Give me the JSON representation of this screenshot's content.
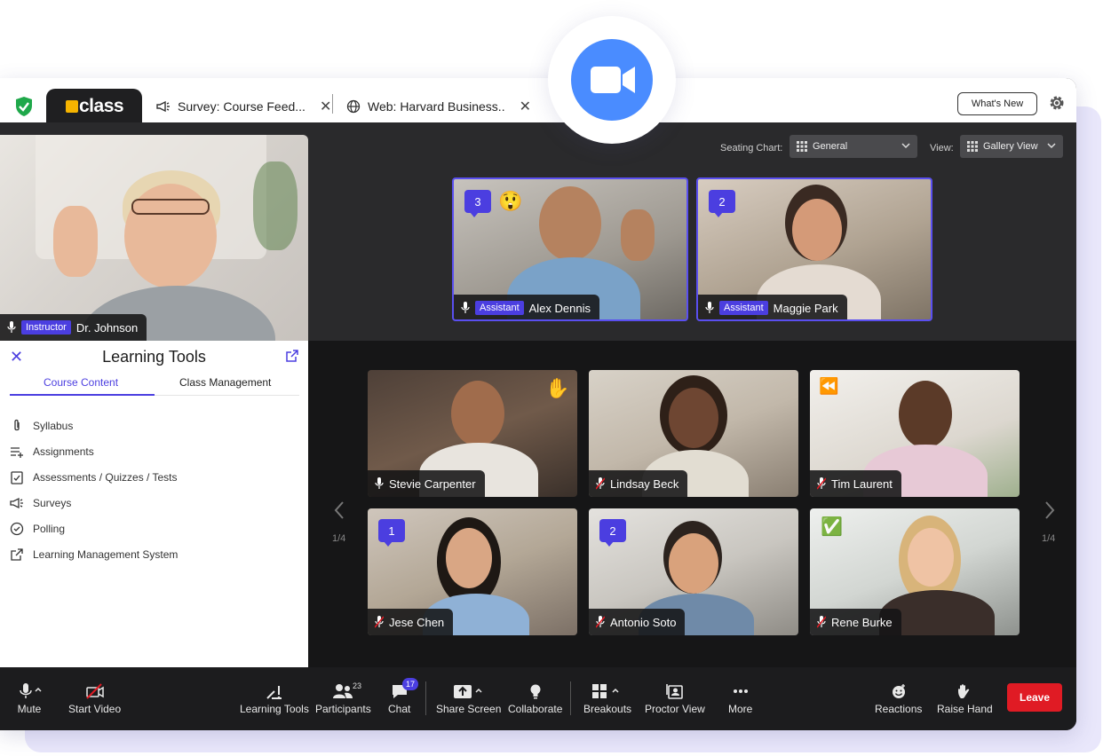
{
  "tabs": {
    "logo": "class",
    "tab1": "Survey: Course Feed...",
    "tab2": "Web: Harvard Business..",
    "whats_new": "What's New"
  },
  "instructor": {
    "role": "Instructor",
    "name": "Dr. Johnson"
  },
  "learning_tools": {
    "title": "Learning Tools",
    "tab_course": "Course Content",
    "tab_class": "Class Management",
    "items": [
      {
        "label": "Syllabus",
        "icon": "paperclip-icon"
      },
      {
        "label": "Assignments",
        "icon": "list-add-icon"
      },
      {
        "label": "Assessments / Quizzes / Tests",
        "icon": "clipboard-check-icon"
      },
      {
        "label": "Surveys",
        "icon": "megaphone-icon"
      },
      {
        "label": "Polling",
        "icon": "check-circle-icon"
      },
      {
        "label": "Learning Management System",
        "icon": "external-link-icon"
      }
    ]
  },
  "controls": {
    "seating_label": "Seating Chart:",
    "seating_value": "General",
    "view_label": "View:",
    "view_value": "Gallery View"
  },
  "assistants": [
    {
      "role": "Assistant",
      "name": "Alex Dennis",
      "badge": "3",
      "emoji": "😲"
    },
    {
      "role": "Assistant",
      "name": "Maggie Park",
      "badge": "2"
    }
  ],
  "students": [
    {
      "name": "Stevie Carpenter",
      "emoji": "✋",
      "muted": false
    },
    {
      "name": "Lindsay Beck",
      "muted": true
    },
    {
      "name": "Tim Laurent",
      "emoji": "⏪",
      "muted": true
    },
    {
      "name": "Jese Chen",
      "badge": "1",
      "muted": true
    },
    {
      "name": "Antonio Soto",
      "badge": "2",
      "muted": true
    },
    {
      "name": "Rene Burke",
      "emoji": "✅",
      "muted": true
    }
  ],
  "pager": {
    "left": "1/4",
    "right": "1/4"
  },
  "toolbar": {
    "mute": "Mute",
    "start_video": "Start Video",
    "learning_tools": "Learning Tools",
    "participants": "Participants",
    "participants_count": "23",
    "chat": "Chat",
    "chat_count": "17",
    "share_screen": "Share Screen",
    "collaborate": "Collaborate",
    "breakouts": "Breakouts",
    "proctor_view": "Proctor View",
    "more": "More",
    "reactions": "Reactions",
    "raise_hand": "Raise Hand",
    "leave": "Leave"
  },
  "colors": {
    "accent": "#4b3ee0",
    "leave": "#e01b24",
    "zoom": "#4a8cff"
  }
}
